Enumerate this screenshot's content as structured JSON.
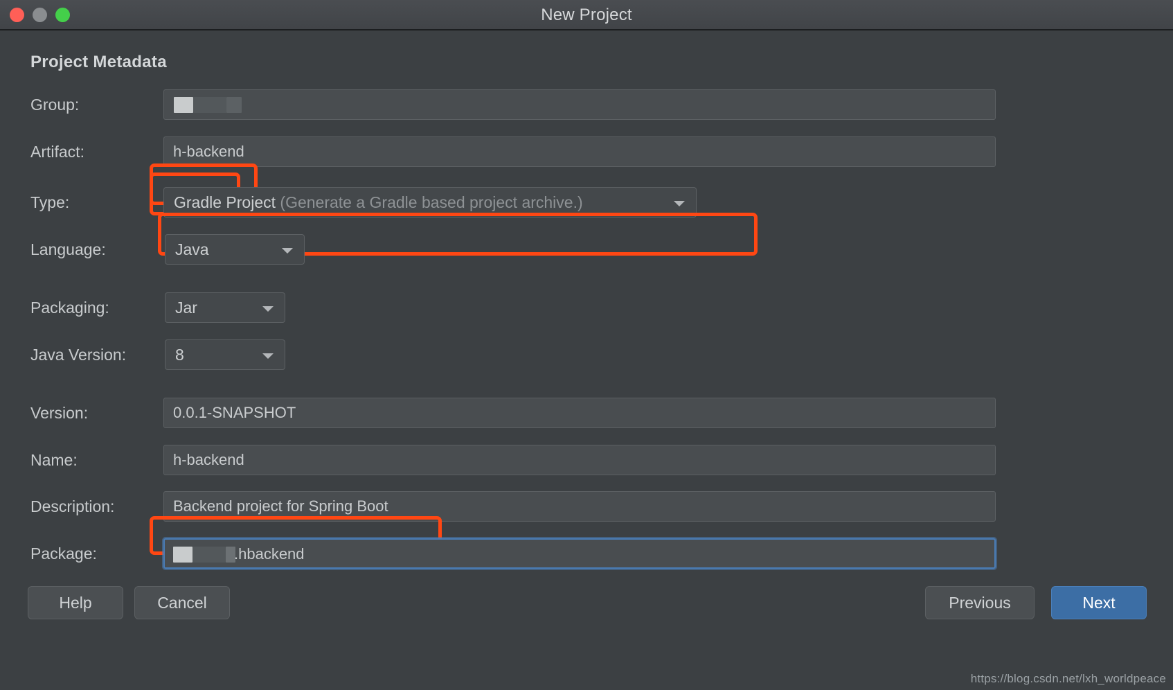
{
  "window": {
    "title": "New Project",
    "traffic_lights": [
      {
        "name": "close",
        "color": "#ff5f57"
      },
      {
        "name": "minimize",
        "color": "#8a8d90"
      },
      {
        "name": "zoom",
        "color": "#44cf4a"
      }
    ]
  },
  "section": {
    "title": "Project Metadata"
  },
  "fields": {
    "group": {
      "label": "Group:",
      "value": "",
      "redacted": true,
      "highlighted": true
    },
    "artifact": {
      "label": "Artifact:",
      "value": "h-backend",
      "highlighted": true
    },
    "type": {
      "label": "Type:",
      "value": "Gradle Project",
      "hint": "(Generate a Gradle based project archive.)",
      "icon": "chevron-down-icon",
      "highlighted": true
    },
    "language": {
      "label": "Language:",
      "value": "Java",
      "icon": "chevron-down-icon",
      "highlighted": false
    },
    "packaging": {
      "label": "Packaging:",
      "value": "Jar",
      "icon": "chevron-down-icon",
      "highlighted": false
    },
    "java_version": {
      "label": "Java Version:",
      "value": "8",
      "icon": "chevron-down-icon",
      "highlighted": false
    },
    "version": {
      "label": "Version:",
      "value": "0.0.1-SNAPSHOT",
      "highlighted": false
    },
    "name": {
      "label": "Name:",
      "value": "h-backend",
      "highlighted": false
    },
    "description": {
      "label": "Description:",
      "value": "Backend project for Spring Boot",
      "highlighted": true
    },
    "package": {
      "label": "Package:",
      "value": ".hbackend",
      "redacted": true,
      "focused": true,
      "highlighted": false
    }
  },
  "buttons": {
    "help": "Help",
    "cancel": "Cancel",
    "previous": "Previous",
    "next": "Next"
  },
  "watermark": "https://blog.csdn.net/lxh_worldpeace",
  "colors": {
    "window_bg": "#3c4043",
    "titlebar_bg": "#45484c",
    "field_bg": "#494d50",
    "annotation": "#ff4713",
    "primary_button": "#3c6ea5",
    "focus_border": "#4a7cb5"
  }
}
